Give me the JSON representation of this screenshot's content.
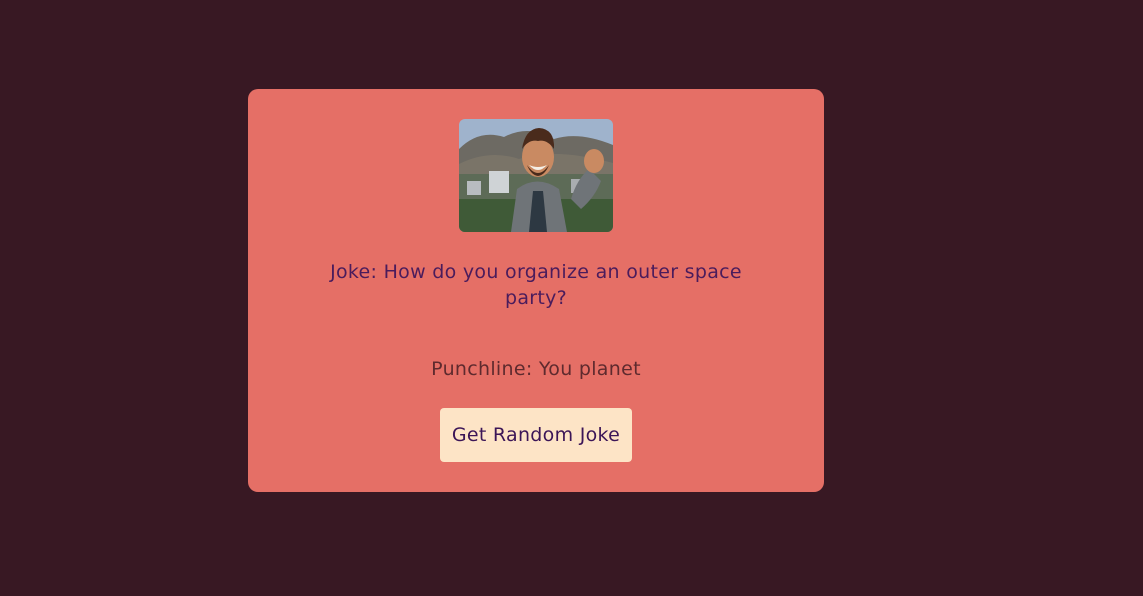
{
  "card": {
    "image": {
      "alt": "meme-image",
      "description_icon": "meme-photo"
    },
    "joke_text": "Joke: How do you organize an outer space party?",
    "punchline_text": "Punchline: You planet",
    "button_label": "Get Random Joke"
  },
  "colors": {
    "background": "#381823",
    "card": "#e56f66",
    "joke_text": "#4a1c5c",
    "punchline_text": "#5e2a2e",
    "button_bg": "#fde4c6",
    "button_text": "#3b1557"
  }
}
